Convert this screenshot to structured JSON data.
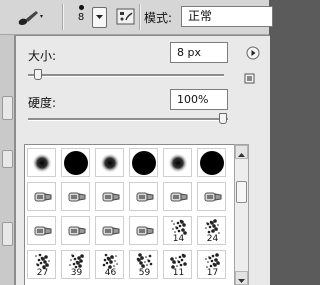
{
  "options_bar": {
    "tool_icon": "brush-tool-icon",
    "brush_size": "8",
    "mode_label": "模式:",
    "mode_value": "正常",
    "toggle_icon": "brush-panel-toggle-icon"
  },
  "brush_panel": {
    "size_label": "大小:",
    "size_value": "8 px",
    "size_slider_level": 0.03,
    "hardness_label": "硬度:",
    "hardness_value": "100%",
    "hardness_slider_level": 1.0,
    "menu_icon": "panel-menu-arrow-icon",
    "save_icon": "new-preset-icon"
  },
  "presets": {
    "row1": [
      {
        "type": "soft",
        "label": ""
      },
      {
        "type": "hard",
        "label": ""
      },
      {
        "type": "soft",
        "label": ""
      },
      {
        "type": "hard",
        "label": ""
      },
      {
        "type": "soft",
        "label": ""
      },
      {
        "type": "hard",
        "label": ""
      }
    ],
    "row2": [
      {
        "type": "bristle",
        "label": ""
      },
      {
        "type": "bristle",
        "label": ""
      },
      {
        "type": "bristle",
        "label": ""
      },
      {
        "type": "bristle",
        "label": ""
      },
      {
        "type": "bristle",
        "label": ""
      },
      {
        "type": "bristle",
        "label": ""
      }
    ],
    "row3": [
      {
        "type": "bristle",
        "label": ""
      },
      {
        "type": "bristle",
        "label": ""
      },
      {
        "type": "bristle",
        "label": ""
      },
      {
        "type": "bristle",
        "label": ""
      },
      {
        "type": "scatter",
        "label": "14"
      },
      {
        "type": "scatter",
        "label": "24"
      }
    ],
    "row4": [
      {
        "type": "scatter",
        "label": "27"
      },
      {
        "type": "scatter",
        "label": "39"
      },
      {
        "type": "scatter",
        "label": "46"
      },
      {
        "type": "scatter",
        "label": "59"
      },
      {
        "type": "scatter",
        "label": "11"
      },
      {
        "type": "scatter",
        "label": "17"
      }
    ]
  },
  "colors": {
    "panel_bg": "#e9e9e9",
    "toolbar_bg": "#d6d6d6",
    "field_bg": "#ffffff"
  }
}
